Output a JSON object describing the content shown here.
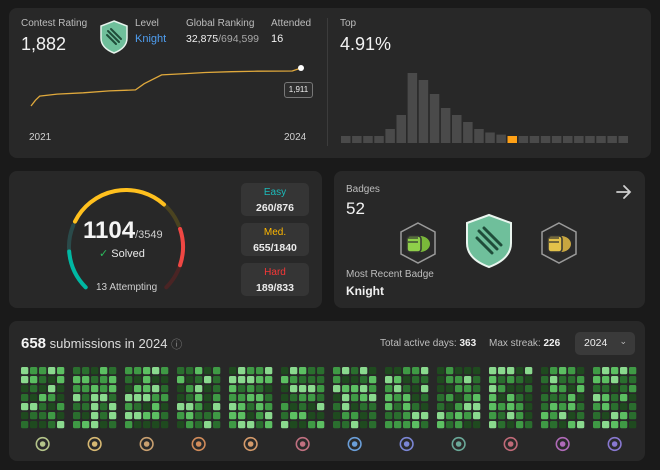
{
  "contest": {
    "rating_label": "Contest Rating",
    "rating": "1,882",
    "level_label": "Level",
    "level": "Knight",
    "global_label": "Global Ranking",
    "global_rank": "32,875",
    "global_total": "/694,599",
    "attended_label": "Attended",
    "attended": "16",
    "top_label": "Top",
    "top_value": "4.91%",
    "chart_start": "2021",
    "chart_end": "2024",
    "tooltip": "1,911"
  },
  "chart_data": [
    {
      "type": "line",
      "x": [
        2021.0,
        2021.05,
        2021.1,
        2021.3,
        2021.6,
        2021.9,
        2022.2,
        2022.3,
        2022.5,
        2022.8,
        2023.0,
        2023.3,
        2023.6,
        2024.0,
        2024.1
      ],
      "y": [
        1545,
        1600,
        1640,
        1660,
        1672,
        1690,
        1700,
        1760,
        1845,
        1858,
        1868,
        1875,
        1880,
        1882,
        1911
      ],
      "xlabel": "",
      "ylabel": ""
    },
    {
      "type": "bar",
      "values": [
        1,
        1,
        1,
        1,
        2,
        4,
        10,
        9,
        7,
        5,
        4,
        3,
        2,
        1.5,
        1.2,
        1,
        1,
        1,
        1,
        1,
        1,
        1,
        1,
        1,
        1,
        1
      ],
      "highlight_index": 15,
      "highlight_color": "#ffa116",
      "bar_color": "#4a4a4a"
    }
  ],
  "solved": {
    "count": "1104",
    "total": "/3549",
    "check": "✓",
    "label": "Solved",
    "attempting": "13 Attempting",
    "easy_label": "Easy",
    "easy_value": "260/876",
    "med_label": "Med.",
    "med_value": "655/1840",
    "hard_label": "Hard",
    "hard_value": "189/833",
    "colors": {
      "easy": "#00b8a3",
      "medium": "#ffc01e",
      "hard": "#ef4743"
    },
    "fractions": {
      "easy": 0.297,
      "medium": 0.356,
      "hard": 0.227
    }
  },
  "badges": {
    "label": "Badges",
    "count": "52",
    "recent_label": "Most Recent Badge",
    "recent": "Knight",
    "arrow_icon": "arrow-right-icon"
  },
  "submissions": {
    "count": "658",
    "title_rest": " submissions in 2024",
    "info_icon": "ⓘ",
    "active_label": "Total active days: ",
    "active_value": "363",
    "streak_label": "Max streak: ",
    "streak_value": "226",
    "year": "2024",
    "months": 12,
    "month_badge_colors": [
      "#b4c48a",
      "#d6b872",
      "#c9a070",
      "#d08b5a",
      "#d49a6a",
      "#c07080",
      "#6a9ed8",
      "#7b86d4",
      "#6aa898",
      "#c06a78",
      "#b06ab8",
      "#8878d0"
    ]
  }
}
